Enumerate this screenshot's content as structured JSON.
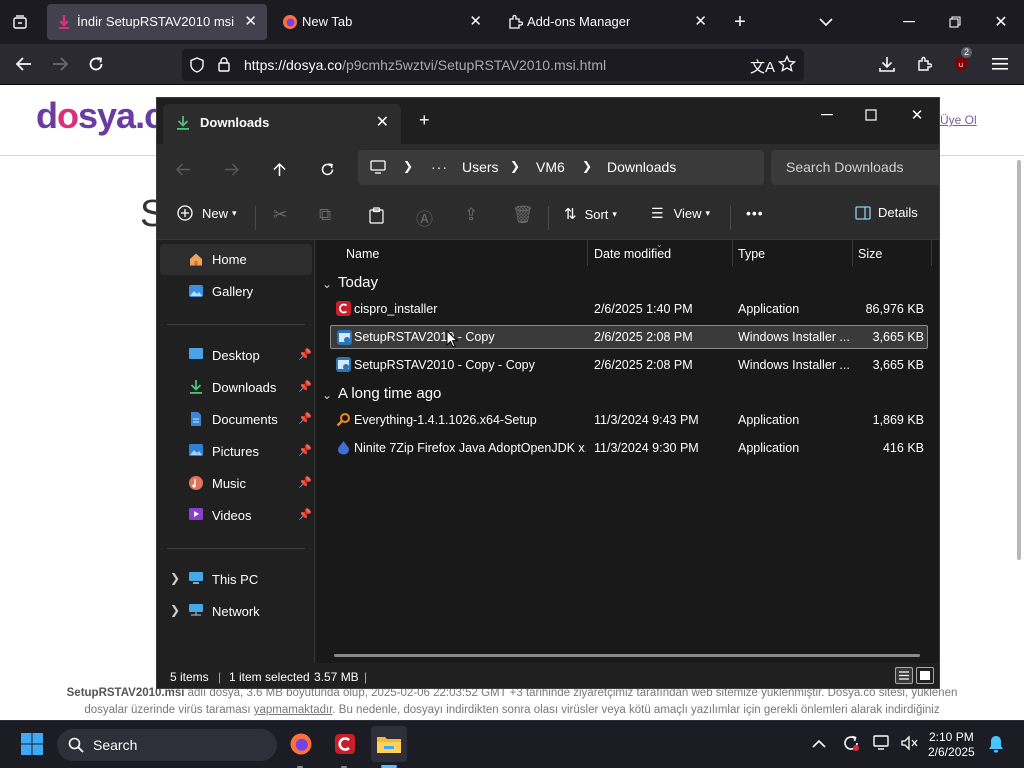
{
  "browser": {
    "tabs": [
      {
        "label": "İndir SetupRSTAV2010 msi",
        "active": true
      },
      {
        "label": "New Tab",
        "active": false
      },
      {
        "label": "Add-ons Manager",
        "active": false
      }
    ],
    "new_tab_label": "+",
    "url_host": "https://dosya.co",
    "url_path": "/p9cmhz5wztvi/SetupRSTAV2010.msi.html",
    "extension_badge": "2"
  },
  "webpage": {
    "logo_a": "d",
    "logo_o": "o",
    "logo_b": "sya.c",
    "login_link": "Üye Ol",
    "big_letter": "S",
    "footer_bold": "SetupRSTAV2010.msi",
    "footer_line1": " adlı dosya, 3.6 MB boyutunda olup, 2025-02-06 22:03:52 GMT +3 tarihinde ziyaretçimiz tarafından web sitemize yüklenmiştir. Dosya.co sitesi, yüklenen",
    "footer_line2a": "dosyalar üzerinde virüs taraması ",
    "footer_link": "yapmamaktadır",
    "footer_line2b": ". Bu nedenle, dosyayı indirdikten sonra olası virüsler veya kötü amaçlı yazılımlar için gerekli önlemleri alarak indirdiğiniz"
  },
  "explorer": {
    "tab_title": "Downloads",
    "breadcrumbs": [
      "Users",
      "VM6",
      "Downloads"
    ],
    "search_placeholder": "Search Downloads",
    "toolbar": {
      "new": "New",
      "sort": "Sort",
      "view": "View",
      "more": "•••",
      "details": "Details"
    },
    "nav": {
      "home": "Home",
      "gallery": "Gallery",
      "desktop": "Desktop",
      "downloads": "Downloads",
      "documents": "Documents",
      "pictures": "Pictures",
      "music": "Music",
      "videos": "Videos",
      "this_pc": "This PC",
      "network": "Network"
    },
    "columns": {
      "name": "Name",
      "date": "Date modified",
      "type": "Type",
      "size": "Size"
    },
    "groups": {
      "today": "Today",
      "long_ago": "A long time ago"
    },
    "files": [
      {
        "name": "cispro_installer",
        "date": "2/6/2025 1:40 PM",
        "type": "Application",
        "size": "86,976 KB"
      },
      {
        "name": "SetupRSTAV2010 - Copy",
        "date": "2/6/2025 2:08 PM",
        "type": "Windows Installer ...",
        "size": "3,665 KB"
      },
      {
        "name": "SetupRSTAV2010 - Copy - Copy",
        "date": "2/6/2025 2:08 PM",
        "type": "Windows Installer ...",
        "size": "3,665 KB"
      },
      {
        "name": "Everything-1.4.1.1026.x64-Setup",
        "date": "11/3/2024 9:43 PM",
        "type": "Application",
        "size": "1,869 KB"
      },
      {
        "name": "Ninite 7Zip Firefox Java AdoptOpenJDK x...",
        "date": "11/3/2024 9:30 PM",
        "type": "Application",
        "size": "416 KB"
      }
    ],
    "status": {
      "items": "5 items",
      "selected": "1 item selected",
      "size": "3.57 MB"
    }
  },
  "taskbar": {
    "search": "Search",
    "time": "2:10 PM",
    "date": "2/6/2025"
  },
  "colors": {
    "explorer_bg": "#202020",
    "selection": "#3a3a3a",
    "accent": "#4cc2ff",
    "brand_purple": "#6a3ca0",
    "brand_pink": "#d9307a"
  }
}
